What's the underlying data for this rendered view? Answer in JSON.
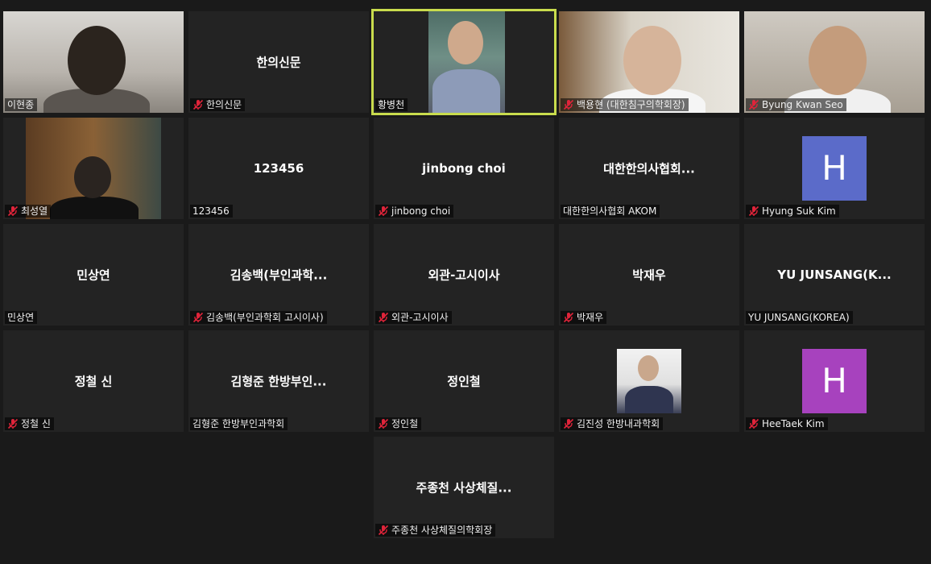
{
  "participants": [
    {
      "name": "이현종",
      "display": "",
      "muted": false,
      "video": "room1",
      "colors": {
        "head": "#2b241e",
        "body": "#5a5550"
      }
    },
    {
      "name": "한의신문",
      "display": "한의신문",
      "muted": true
    },
    {
      "name": "황병천",
      "display": "",
      "muted": false,
      "video": "person-b",
      "active": true,
      "colors": {
        "head": "#cfa98c",
        "body": "#8d9bb8"
      }
    },
    {
      "name": "백용현 (대한침구의학회장)",
      "display": "",
      "muted": true,
      "video": "office",
      "colors": {
        "head": "#d6b49a",
        "body": "#f5f5f5"
      }
    },
    {
      "name": "Byung Kwan Seo",
      "display": "",
      "muted": true,
      "video": "room2",
      "colors": {
        "head": "#c49c7c",
        "body": "#f0f0f0"
      }
    },
    {
      "name": "최성열",
      "display": "",
      "muted": true,
      "video": "door",
      "colors": {
        "head": "#2a2420",
        "body": "#111111"
      }
    },
    {
      "name": "123456",
      "display": "123456",
      "muted": false
    },
    {
      "name": "jinbong choi",
      "display": "jinbong choi",
      "muted": true
    },
    {
      "name": "대한한의사협회 AKOM",
      "display": "대한한의사협회...",
      "muted": false
    },
    {
      "name": "Hyung Suk Kim",
      "display": "",
      "muted": true,
      "avatar": "H",
      "colors": {
        "avatar": "#5b6bc9"
      }
    },
    {
      "name": "민상연",
      "display": "민상연",
      "muted": false
    },
    {
      "name": "김송백(부인과학회 고시이사)",
      "display": "김송백(부인과학...",
      "muted": true
    },
    {
      "name": "외관-고시이사",
      "display": "외관-고시이사",
      "muted": true
    },
    {
      "name": "박재우",
      "display": "박재우",
      "muted": true
    },
    {
      "name": "YU JUNSANG(KOREA)",
      "display": "YU JUNSANG(K...",
      "muted": false
    },
    {
      "name": "정철 신",
      "display": "정철 신",
      "muted": true
    },
    {
      "name": "김형준 한방부인과학회",
      "display": "김형준 한방부인...",
      "muted": false
    },
    {
      "name": "정인철",
      "display": "정인철",
      "muted": true
    },
    {
      "name": "김진성 한방내과학회",
      "display": "",
      "muted": true,
      "video": "portrait",
      "colors": {
        "head": "#c9a78c",
        "body": "#2f3550"
      }
    },
    {
      "name": "HeeTaek Kim",
      "display": "",
      "muted": true,
      "avatar": "H",
      "colors": {
        "avatar": "#a742be"
      }
    },
    {
      "name": "주종천 사상체질의학회장",
      "display": "주종천 사상체질...",
      "muted": true
    }
  ],
  "colors": {
    "background": "#1a1a1a",
    "tile": "#232323",
    "active_border": "#c9dc4d",
    "mute_icon": "#e0243a"
  }
}
